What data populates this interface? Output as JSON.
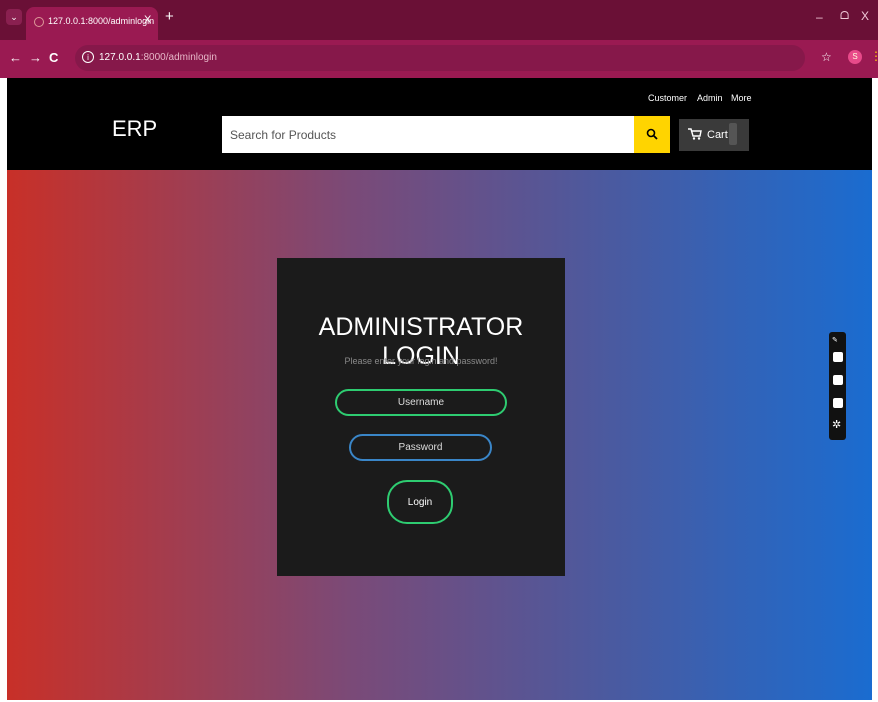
{
  "browser": {
    "tab_title": "127.0.0.1:8000/adminlogin",
    "tab_close": "X",
    "new_tab": "+",
    "url_host": "127.0.0.1",
    "url_rest": ":8000/adminlogin",
    "nav": {
      "back": "←",
      "forward": "→",
      "reload": "C"
    },
    "window": {
      "minimize": "–",
      "maximize": "ᗝ",
      "close": "X"
    },
    "profile_letter": "S",
    "accent_color": "#9a1a52"
  },
  "site": {
    "logo": "ERP",
    "search_placeholder": "Search for Products",
    "cart_label": "Cart",
    "links": [
      "Customer",
      "Admin",
      "More"
    ],
    "search_btn_color": "#ffd400"
  },
  "login": {
    "title": "ADMINISTRATOR LOGIN",
    "subtitle": "Please enter your login and password!",
    "username_placeholder": "Username",
    "password_placeholder": "Password",
    "button_label": "Login",
    "username_border_color": "#2ecc71",
    "password_border_color": "#3a86c8"
  },
  "background": {
    "gradient_left": "#c83028",
    "gradient_right": "#1a6cd0"
  },
  "extension_icons": [
    "brush-icon",
    "camera-icon",
    "video-icon",
    "window-icon",
    "settings-icon"
  ]
}
